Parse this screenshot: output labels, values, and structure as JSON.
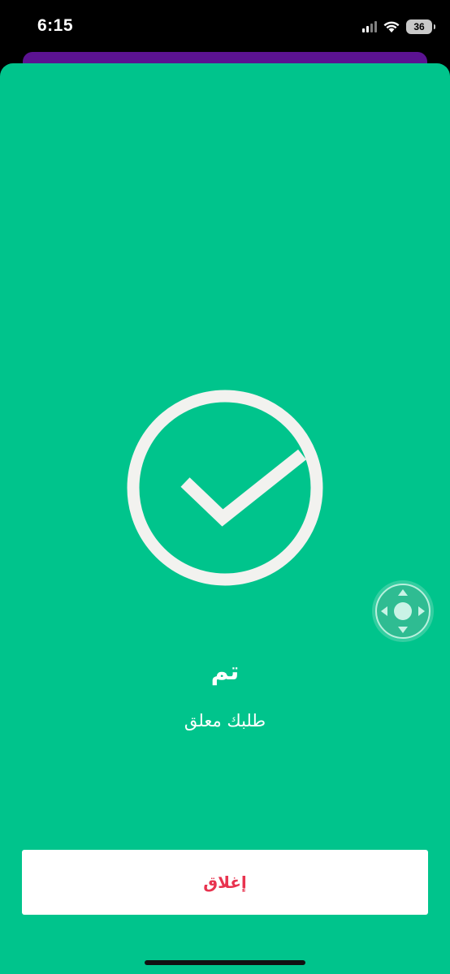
{
  "status_bar": {
    "time": "6:15",
    "battery_level": "36",
    "icons": [
      "cellular-signal-icon",
      "wifi-icon",
      "battery-icon"
    ]
  },
  "confirmation": {
    "icon": "check-circle-icon",
    "title": "تم",
    "message": "طلبك معلق"
  },
  "close_button": {
    "label": "إغلاق"
  },
  "floating_control": {
    "icon": "dpad-icon"
  },
  "colors": {
    "background": "#00c48c",
    "back_sheet": "#5b1391",
    "button_text": "#e8334f",
    "icon_stroke": "#f2f2ef"
  }
}
